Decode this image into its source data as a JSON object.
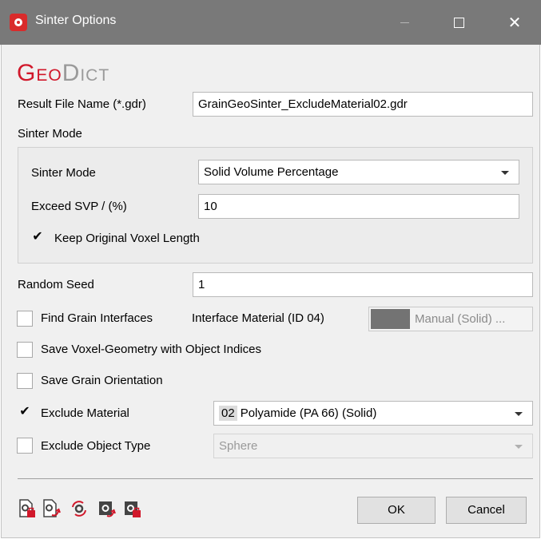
{
  "window": {
    "title": "Sinter Options",
    "controls": {
      "minimize": "",
      "maximize": "",
      "close": "✕"
    }
  },
  "logo": {
    "part1": "Geo",
    "part2": "Dict"
  },
  "result_file": {
    "label": "Result File Name (*.gdr)",
    "value": "GrainGeoSinter_ExcludeMaterial02.gdr"
  },
  "sinter_mode_group": {
    "title": "Sinter Mode",
    "mode_label": "Sinter Mode",
    "mode_value": "Solid Volume Percentage",
    "exceed_label": "Exceed SVP / (%)",
    "exceed_value": "10",
    "keep_voxel_label": "Keep Original Voxel Length",
    "keep_voxel_checked": true
  },
  "random_seed": {
    "label": "Random Seed",
    "value": "1"
  },
  "find_grain_interfaces": {
    "label": "Find Grain Interfaces",
    "checked": false,
    "interface_label": "Interface Material (ID 04)",
    "interface_button": "Manual (Solid) ...",
    "swatch_color": "#737373"
  },
  "save_voxel_geometry": {
    "label": "Save Voxel-Geometry with Object Indices",
    "checked": false
  },
  "save_grain_orientation": {
    "label": "Save Grain Orientation",
    "checked": false
  },
  "exclude_material": {
    "label": "Exclude Material",
    "checked": true,
    "id": "02",
    "value": "Polyamide (PA 66) (Solid)"
  },
  "exclude_object_type": {
    "label": "Exclude Object Type",
    "checked": false,
    "value": "Sphere"
  },
  "footer": {
    "ok_label": "OK",
    "cancel_label": "Cancel",
    "tools": [
      "load-settings-icon",
      "save-settings-icon",
      "reset-settings-icon",
      "load-macro-icon",
      "save-macro-icon"
    ]
  },
  "colors": {
    "accent_red": "#d1182b",
    "title_bar": "#797979"
  }
}
